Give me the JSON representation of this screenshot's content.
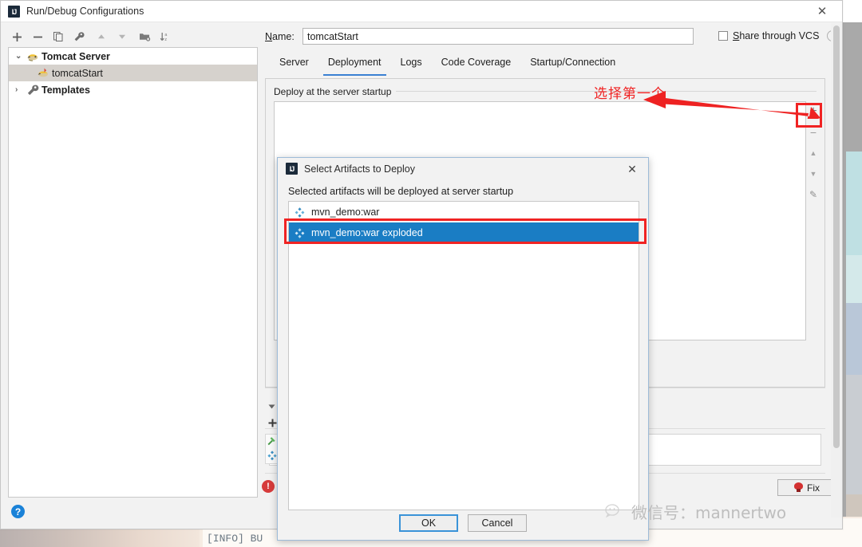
{
  "window": {
    "title": "Run/Debug Configurations",
    "app_icon": "intellij-idea-icon",
    "close_label": "✕"
  },
  "left_toolbar": {
    "buttons": [
      {
        "name": "add-configuration-button",
        "icon": "plus-icon"
      },
      {
        "name": "remove-configuration-button",
        "icon": "minus-icon"
      },
      {
        "name": "copy-configuration-button",
        "icon": "copy-icon"
      },
      {
        "name": "edit-templates-button",
        "icon": "wrench-icon"
      },
      {
        "name": "move-up-button",
        "icon": "arrow-up-icon"
      },
      {
        "name": "move-down-button",
        "icon": "arrow-down-icon"
      },
      {
        "name": "move-into-folder-button",
        "icon": "folder-add-icon"
      },
      {
        "name": "sort-configurations-button",
        "icon": "sort-az-icon"
      }
    ]
  },
  "tree": {
    "items": [
      {
        "label": "Tomcat Server",
        "icon": "tomcat-icon",
        "twisty": "⌄",
        "level": 0,
        "bold": true,
        "selected": false
      },
      {
        "label": "tomcatStart",
        "icon": "tomcat-run-icon",
        "twisty": "",
        "level": 1,
        "bold": false,
        "selected": true
      },
      {
        "label": "Templates",
        "icon": "wrench-icon",
        "twisty": "›",
        "level": 0,
        "bold": true,
        "selected": false
      }
    ]
  },
  "help": {
    "icon": "help-icon",
    "glyph": "?"
  },
  "form": {
    "name_label": "Name:",
    "name_label_mnemonic": "N",
    "name_value": "tomcatStart",
    "share_vcs_label": "Share through VCS",
    "share_vcs_mnemonic": "S",
    "share_vcs_checked": false,
    "help_glyph": "?"
  },
  "tabs": {
    "items": [
      {
        "label": "Server",
        "active": false
      },
      {
        "label": "Deployment",
        "active": true
      },
      {
        "label": "Logs",
        "active": false
      },
      {
        "label": "Code Coverage",
        "active": false
      },
      {
        "label": "Startup/Connection",
        "active": false
      }
    ],
    "active_index": 1
  },
  "deployment": {
    "group_label": "Deploy at the server startup",
    "side_buttons": [
      {
        "name": "add-artifact-button",
        "glyph": "+"
      },
      {
        "name": "remove-artifact-button",
        "glyph": "−"
      },
      {
        "name": "move-artifact-up-button",
        "glyph": "▲"
      },
      {
        "name": "move-artifact-down-button",
        "glyph": "▼"
      },
      {
        "name": "edit-artifact-button",
        "glyph": "✎"
      }
    ]
  },
  "before_launch": {
    "icons": [
      {
        "name": "collapse-arrow-icon",
        "glyph": "▼"
      },
      {
        "name": "add-task-icon",
        "glyph": "+"
      },
      {
        "name": "build-hammer-icon",
        "glyph": ""
      },
      {
        "name": "build-artifacts-icon",
        "glyph": ""
      }
    ]
  },
  "status": {
    "error_icon": "error-icon",
    "error_glyph": "!",
    "fix_label": "Fix",
    "fix_icon": "lightbulb-icon"
  },
  "artifact_dialog": {
    "icon": "intellij-idea-icon",
    "title": "Select Artifacts to Deploy",
    "close_label": "✕",
    "description": "Selected artifacts will be deployed at server startup",
    "items": [
      {
        "label": "mvn_demo:war",
        "icon": "artifact-icon",
        "selected": false
      },
      {
        "label": "mvn_demo:war exploded",
        "icon": "artifact-icon",
        "selected": true
      }
    ],
    "ok_label": "OK",
    "cancel_label": "Cancel"
  },
  "annotations": {
    "text": "选择第一个",
    "color": "#f02323",
    "arrow_name": "red-arrow-annotation",
    "highlight_plus_name": "red-box-around-add-button",
    "highlight_selection_name": "red-box-around-selected-artifact"
  },
  "watermark": {
    "icon": "wechat-icon",
    "text": "微信号：mannertwo"
  },
  "background": {
    "console_text": "[INFO] BU"
  },
  "colors": {
    "accent_blue": "#3a80d2",
    "selection_blue": "#1a7dc4",
    "annotation_red": "#f02323",
    "error_red": "#d63b3b",
    "window_bg": "#f2f2f2"
  }
}
